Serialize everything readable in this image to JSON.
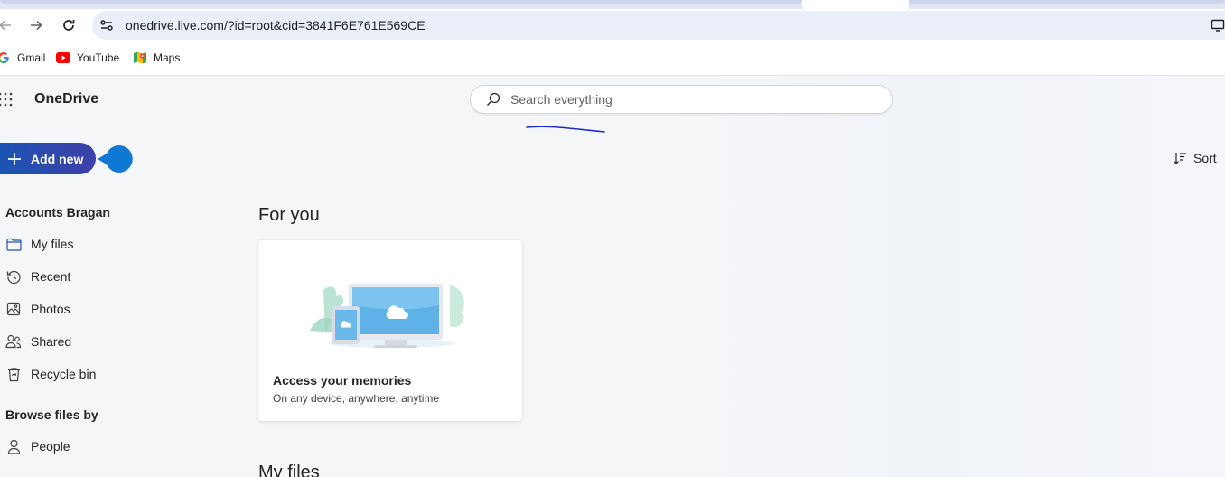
{
  "browser": {
    "url": "onedrive.live.com/?id=root&cid=3841F6E761E569CE",
    "bookmarks": [
      {
        "label": "Gmail",
        "icon": "google-icon"
      },
      {
        "label": "YouTube",
        "icon": "youtube-icon"
      },
      {
        "label": "Maps",
        "icon": "maps-icon"
      }
    ]
  },
  "app": {
    "title": "OneDrive",
    "search_placeholder": "Search everything",
    "add_new_label": "Add new",
    "sort_label": "Sort",
    "accent": "#1d54b4"
  },
  "sidebar": {
    "account_name": "Accounts Bragan",
    "items": [
      {
        "label": "My files",
        "icon": "folder-icon",
        "selected": true
      },
      {
        "label": "Recent",
        "icon": "history-icon"
      },
      {
        "label": "Photos",
        "icon": "image-icon"
      },
      {
        "label": "Shared",
        "icon": "people-icon"
      },
      {
        "label": "Recycle bin",
        "icon": "recycle-bin-icon"
      }
    ],
    "browse_title": "Browse files by",
    "browse_items": [
      {
        "label": "People",
        "icon": "person-icon"
      }
    ]
  },
  "main": {
    "for_you_heading": "For you",
    "card": {
      "title": "Access your memories",
      "subtitle": "On any device, anywhere, anytime"
    },
    "my_files_heading": "My files"
  }
}
